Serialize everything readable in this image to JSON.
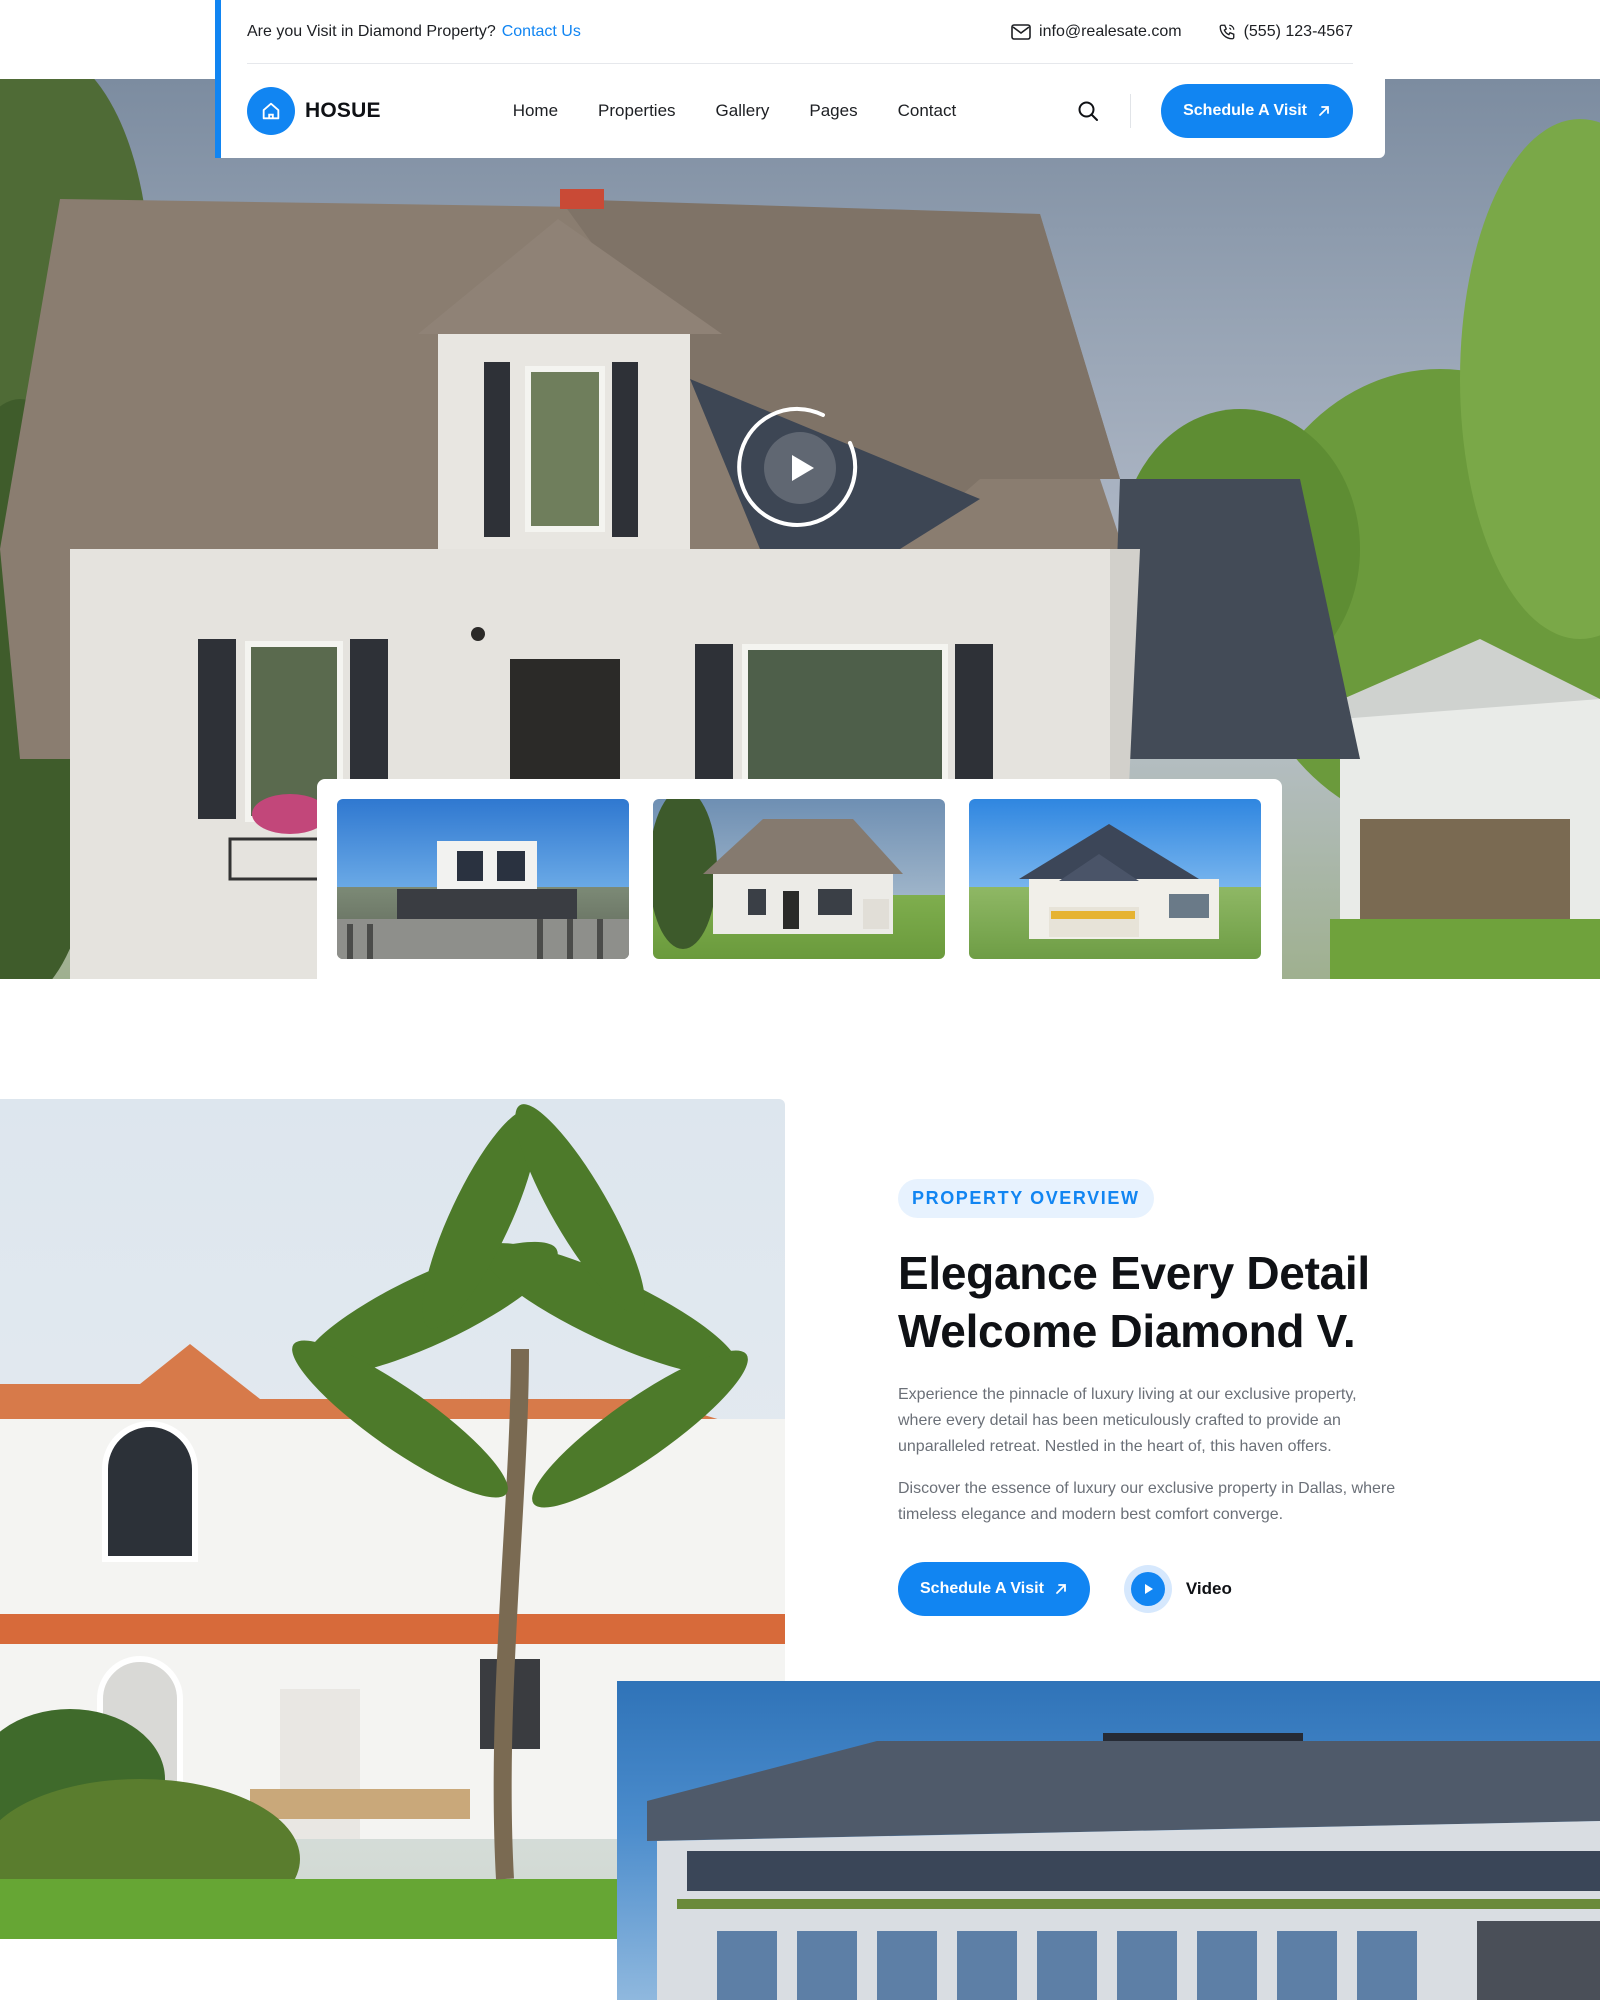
{
  "topbar": {
    "question": "Are you Visit in Diamond Property?",
    "contact_link": "Contact Us",
    "email": "info@realesate.com",
    "phone": "(555) 123-4567"
  },
  "brand": {
    "name": "HOSUE"
  },
  "nav": {
    "items": [
      "Home",
      "Properties",
      "Gallery",
      "Pages",
      "Contact"
    ],
    "cta": "Schedule A Visit"
  },
  "overview": {
    "badge": "PROPERTY OVERVIEW",
    "title_line1": "Elegance Every Detail",
    "title_line2": "Welcome Diamond V.",
    "paragraph1": "Experience the pinnacle of luxury living at our exclusive property, where every detail has been meticulously crafted to provide an unparalleled retreat. Nestled in the heart of, this haven offers.",
    "paragraph2": "Discover the essence of luxury  our exclusive property in Dallas, where timeless elegance and modern best comfort converge.",
    "cta": "Schedule A Visit",
    "video_label": "Video"
  },
  "colors": {
    "accent": "#1185f2",
    "text": "#0f1115",
    "muted": "#6b7078",
    "badge_bg": "#e7f2fe"
  },
  "icons": [
    "home-icon",
    "envelope-icon",
    "phone-icon",
    "search-icon",
    "arrow-up-right-icon",
    "play-icon"
  ]
}
